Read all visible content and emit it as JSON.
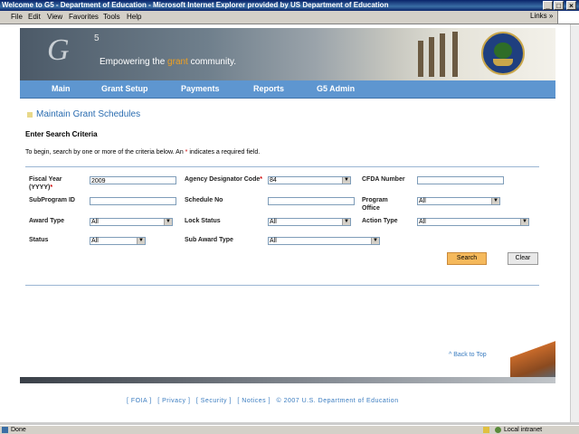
{
  "window": {
    "title": "Welcome to G5 - Department of Education - Microsoft Internet Explorer provided by US Department of Education",
    "minimize_glyph": "_",
    "maximize_glyph": "□",
    "close_glyph": "×"
  },
  "menubar": {
    "items": [
      "File",
      "Edit",
      "View",
      "Favorites",
      "Tools",
      "Help"
    ],
    "links_label": "Links",
    "links_arrow": "»"
  },
  "banner": {
    "logo_text": "G",
    "logo_sup": "5",
    "tagline_pre": "Empowering the ",
    "tagline_highlight": "grant",
    "tagline_post": " community.",
    "seal_icon": "department-of-education-seal-icon"
  },
  "nav": {
    "items": [
      "Main",
      "Grant Setup",
      "Payments",
      "Reports",
      "G5 Admin"
    ]
  },
  "page": {
    "heading": "Maintain Grant Schedules",
    "subheading": "Enter Search Criteria",
    "instruction_pre": "To begin, search by one or more of the criteria below. An ",
    "instruction_star": "*",
    "instruction_post": " indicates a required field."
  },
  "form": {
    "fiscal_year": {
      "label": "Fiscal Year (YYYY)",
      "required": "*",
      "value": "2009"
    },
    "agency_code": {
      "label": "Agency Designator Code",
      "required": "*",
      "value": "84"
    },
    "cfda": {
      "label": "CFDA Number",
      "value": ""
    },
    "subprogram": {
      "label": "SubProgram ID",
      "value": ""
    },
    "schedule_no": {
      "label": "Schedule No",
      "value": ""
    },
    "program_office": {
      "label": "Program Office",
      "value": "All"
    },
    "award_type": {
      "label": "Award Type",
      "value": "All"
    },
    "lock_status": {
      "label": "Lock Status",
      "value": "All"
    },
    "action_type": {
      "label": "Action Type",
      "value": "All"
    },
    "status": {
      "label": "Status",
      "value": "All"
    },
    "sub_award_type": {
      "label": "Sub Award Type",
      "value": "All"
    },
    "dropdown_glyph": "▼",
    "search_label": "Search",
    "clear_label": "Clear"
  },
  "links": {
    "back_to_top": "^ Back to Top"
  },
  "footer": {
    "items": [
      "[ FOIA ]",
      "[ Privacy ]",
      "[ Security ]",
      "[ Notices ]",
      "© 2007 U.S. Department of Education"
    ]
  },
  "statusbar": {
    "status": "Done",
    "zone": "Local intranet"
  }
}
